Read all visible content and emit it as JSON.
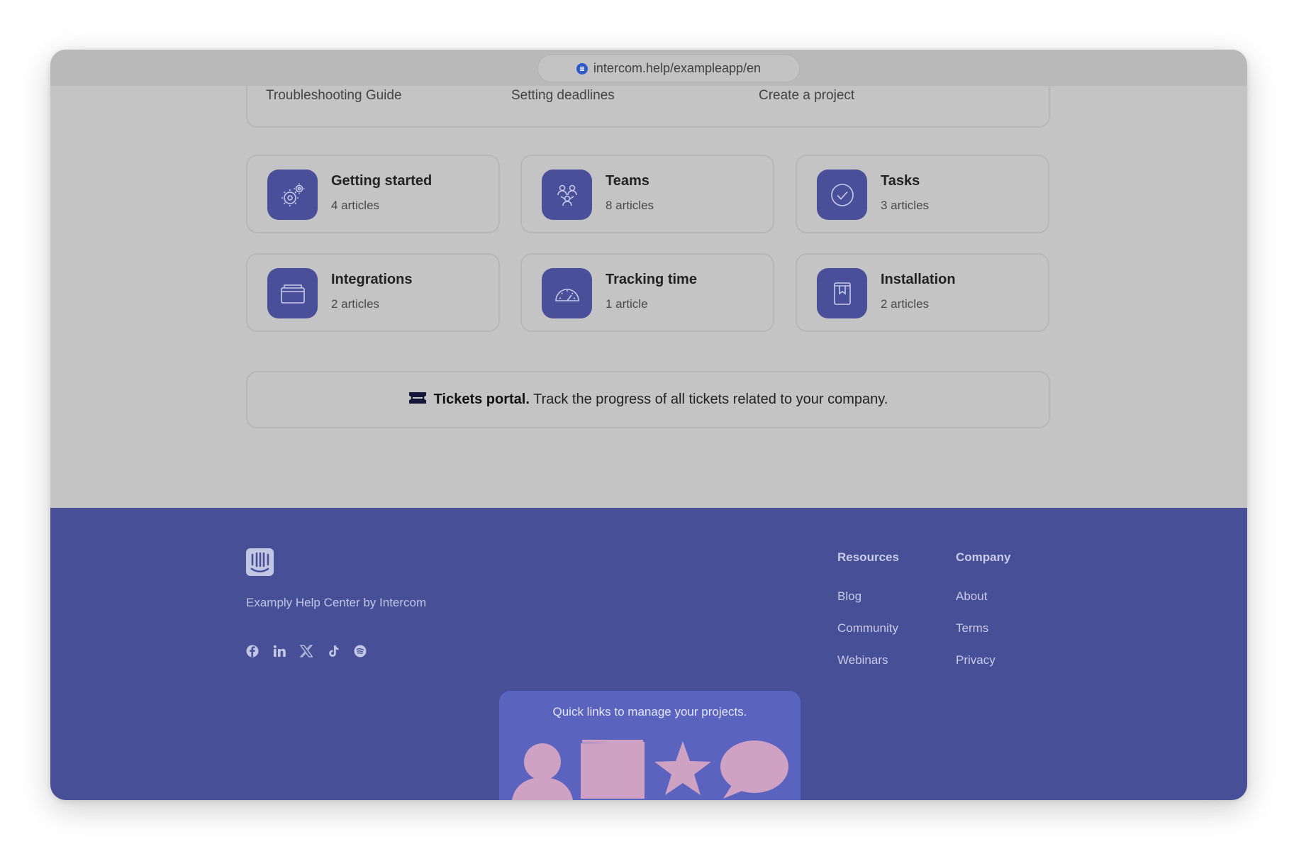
{
  "browser": {
    "url": "intercom.help/exampleapp/en"
  },
  "quick_links": [
    "Troubleshooting Guide",
    "Setting deadlines",
    "Create a project"
  ],
  "collections": [
    {
      "title": "Getting started",
      "count": "4 articles",
      "icon": "gears-icon"
    },
    {
      "title": "Teams",
      "count": "8 articles",
      "icon": "team-icon"
    },
    {
      "title": "Tasks",
      "count": "3 articles",
      "icon": "check-circle-icon"
    },
    {
      "title": "Integrations",
      "count": "2 articles",
      "icon": "folder-icon"
    },
    {
      "title": "Tracking time",
      "count": "1 article",
      "icon": "speedometer-icon"
    },
    {
      "title": "Installation",
      "count": "2 articles",
      "icon": "bookmark-icon"
    }
  ],
  "tickets": {
    "title": "Tickets portal.",
    "description": "Track the progress of all tickets related to your company.",
    "icon": "ticket-icon"
  },
  "footer": {
    "tagline": "Examply Help Center by Intercom",
    "socials": [
      "facebook-icon",
      "linkedin-icon",
      "x-icon",
      "tiktok-icon",
      "spotify-icon"
    ],
    "resources": {
      "heading": "Resources",
      "links": [
        "Blog",
        "Community",
        "Webinars"
      ]
    },
    "company": {
      "heading": "Company",
      "links": [
        "About",
        "Terms",
        "Privacy"
      ]
    },
    "promo": {
      "text": "Quick links to manage your projects."
    }
  },
  "colors": {
    "footer_bg": "#474f97",
    "icon_tile": "#4a4f99",
    "promo_bg": "#5a64bf",
    "promo_shapes": "#cfa2c4",
    "overlay_grey": "#c4c4c4"
  }
}
